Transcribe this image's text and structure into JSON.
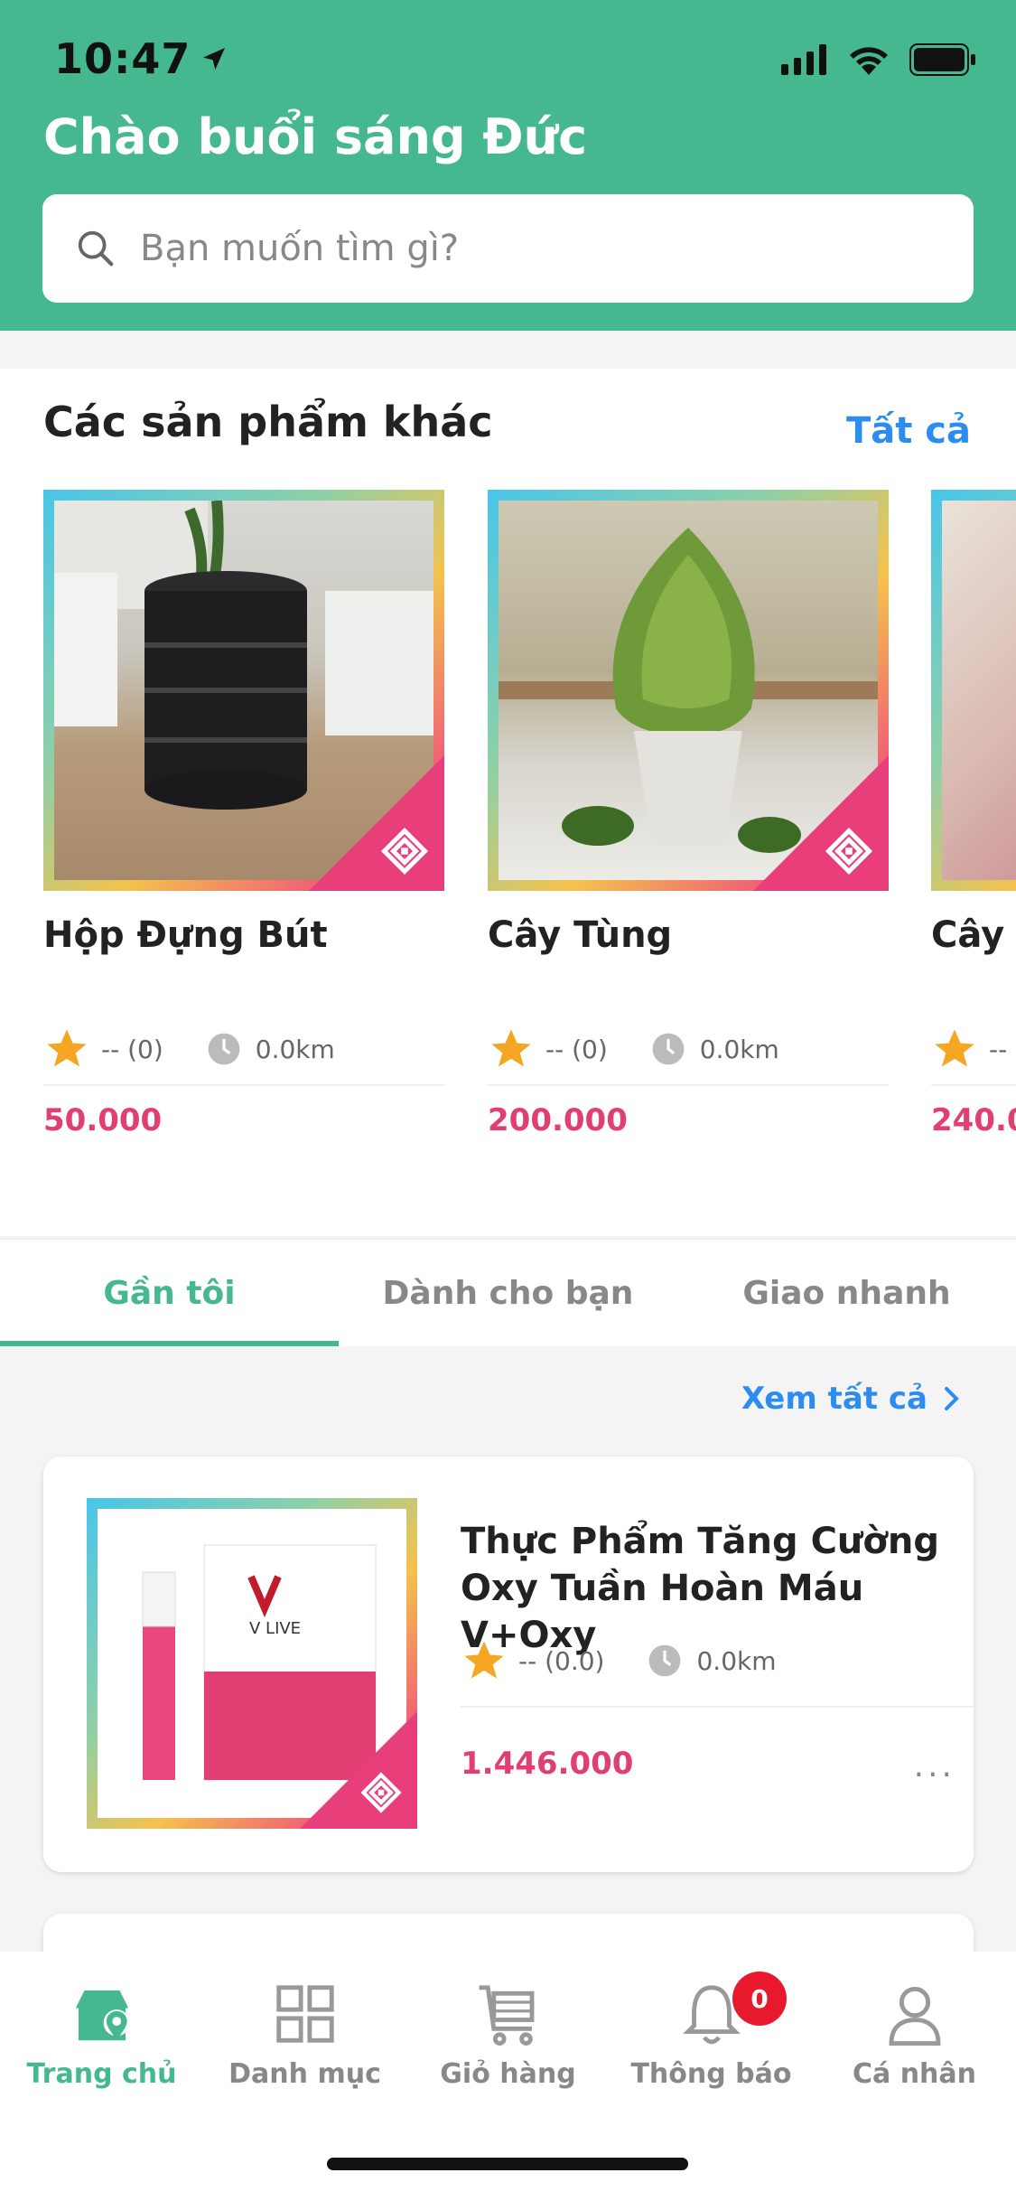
{
  "status_bar": {
    "time": "10:47"
  },
  "header": {
    "greeting": "Chào buổi sáng Đức",
    "search_placeholder": "Bạn muốn tìm gì?"
  },
  "products_section": {
    "title": "Các sản phẩm khác",
    "see_all": "Tất cả",
    "items": [
      {
        "name": "Hộp Đựng Bút",
        "rating": "-- (0)",
        "distance": "0.0km",
        "price": "50.000"
      },
      {
        "name": "Cây Tùng",
        "rating": "-- (0)",
        "distance": "0.0km",
        "price": "200.000"
      },
      {
        "name": "Cây ",
        "rating": "--",
        "distance": "",
        "price": "240.0"
      }
    ]
  },
  "tabs": [
    {
      "label": "Gần tôi",
      "active": true
    },
    {
      "label": "Dành cho bạn",
      "active": false
    },
    {
      "label": "Giao nhanh",
      "active": false
    }
  ],
  "view_all": "Xem tất cả",
  "list_item": {
    "name": "Thực Phẩm Tăng Cường Oxy Tuần Hoàn Máu V+Oxy",
    "rating": "-- (0.0)",
    "distance": "0.0km",
    "price": "1.446.000",
    "more": "...",
    "product_box_text": "V LIVE"
  },
  "bottom_nav": [
    {
      "label": "Trang chủ",
      "icon": "home-icon",
      "active": true
    },
    {
      "label": "Danh mục",
      "icon": "grid-icon",
      "active": false
    },
    {
      "label": "Giỏ hàng",
      "icon": "cart-icon",
      "active": false
    },
    {
      "label": "Thông báo",
      "icon": "bell-icon",
      "active": false,
      "badge": "0"
    },
    {
      "label": "Cá nhân",
      "icon": "user-icon",
      "active": false
    }
  ],
  "colors": {
    "brand": "#45b890",
    "link": "#2c8cf0",
    "price": "#e13e72",
    "badge": "#e8192c"
  }
}
